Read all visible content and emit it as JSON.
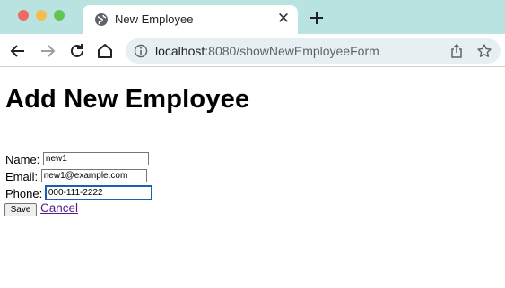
{
  "browser": {
    "tab_title": "New Employee",
    "url_host": "localhost",
    "url_path": ":8080/showNewEmployeeForm",
    "icons": {
      "tab": "globe-icon",
      "close": "close-icon",
      "new_tab": "plus-icon",
      "back": "back-arrow-icon",
      "forward": "forward-arrow-icon",
      "reload": "reload-icon",
      "home": "home-icon",
      "info": "info-icon",
      "share": "share-icon",
      "bookmark": "star-icon"
    }
  },
  "page": {
    "heading": "Add New Employee",
    "form": {
      "name_label": "Name:",
      "name_value": "new1",
      "email_label": "Email:",
      "email_value": "new1@example.com",
      "phone_label": "Phone:",
      "phone_value": "000-111-2222",
      "save_label": "Save",
      "cancel_label": "Cancel"
    }
  }
}
